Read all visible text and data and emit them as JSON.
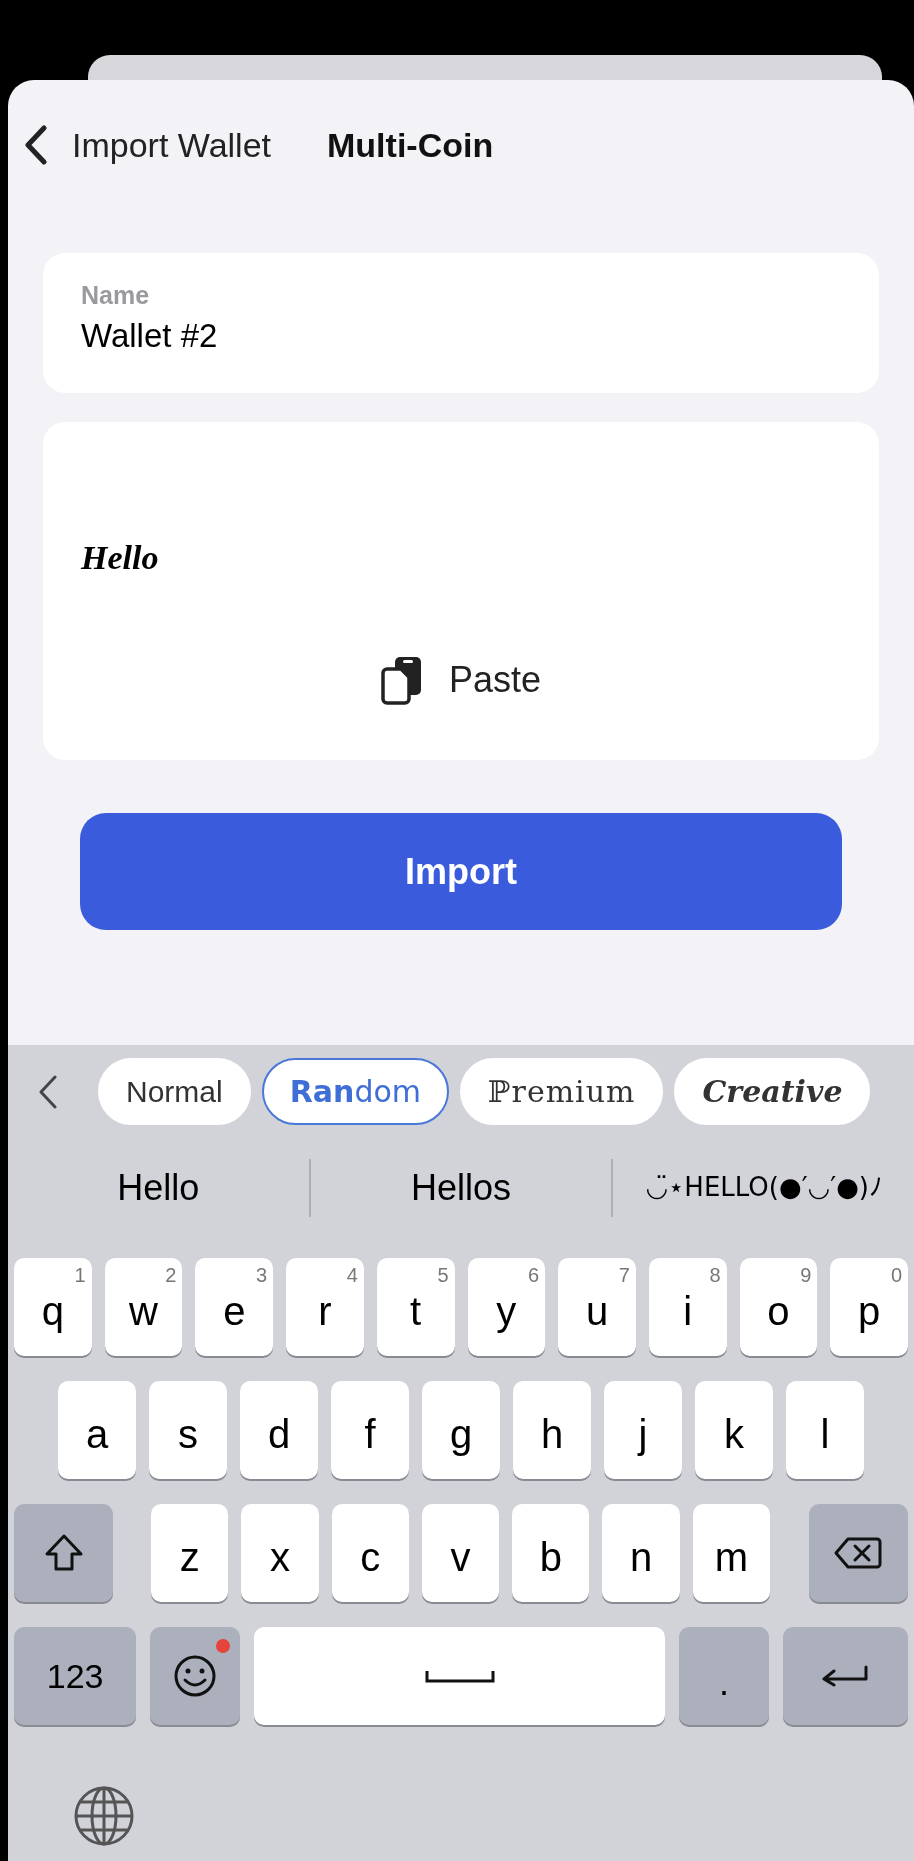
{
  "nav": {
    "back_label": "Import Wallet",
    "title": "Multi-Coin"
  },
  "name_field": {
    "label": "Name",
    "value": "Wallet #2"
  },
  "phrase_field": {
    "value": "Hello",
    "paste_label": "Paste"
  },
  "import_button": "Import",
  "keyboard": {
    "styles": [
      {
        "label": "Normal",
        "kind": "normal",
        "selected": false
      },
      {
        "label": "**Ran**dom",
        "kind": "random",
        "selected": true
      },
      {
        "label": "ℙremium",
        "kind": "premium",
        "selected": false
      },
      {
        "label": "Creative",
        "kind": "creative",
        "selected": false
      }
    ],
    "suggestions": [
      "Hello",
      "Hellos",
      "◡̈⋆HELLO(●′◡′●)ﾉ"
    ],
    "rows": [
      [
        {
          "label": "q",
          "hint": "1"
        },
        {
          "label": "w",
          "hint": "2"
        },
        {
          "label": "e",
          "hint": "3"
        },
        {
          "label": "r",
          "hint": "4"
        },
        {
          "label": "t",
          "hint": "5"
        },
        {
          "label": "y",
          "hint": "6"
        },
        {
          "label": "u",
          "hint": "7"
        },
        {
          "label": "i",
          "hint": "8"
        },
        {
          "label": "o",
          "hint": "9"
        },
        {
          "label": "p",
          "hint": "0"
        }
      ],
      [
        {
          "label": "a"
        },
        {
          "label": "s"
        },
        {
          "label": "d"
        },
        {
          "label": "f"
        },
        {
          "label": "g"
        },
        {
          "label": "h"
        },
        {
          "label": "j"
        },
        {
          "label": "k"
        },
        {
          "label": "l"
        }
      ],
      [
        {
          "label": "z"
        },
        {
          "label": "x"
        },
        {
          "label": "c"
        },
        {
          "label": "v"
        },
        {
          "label": "b"
        },
        {
          "label": "n"
        },
        {
          "label": "m"
        }
      ]
    ],
    "mode_key": "123",
    "period_key": ".",
    "emoji_notification": true
  }
}
